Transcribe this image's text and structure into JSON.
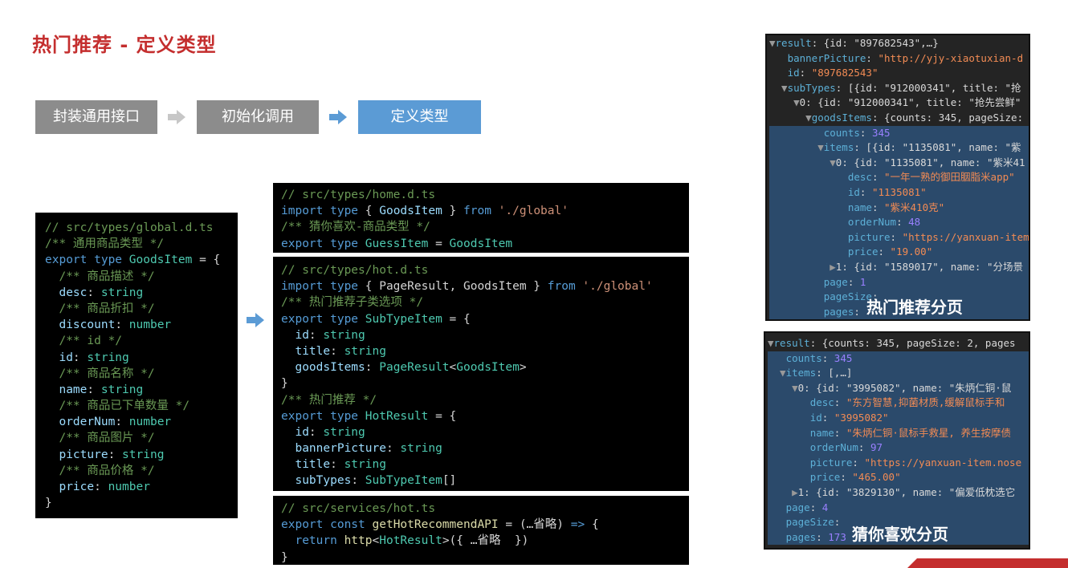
{
  "page_title": "热门推荐 - 定义类型",
  "steps": [
    {
      "label": "封装通用接口"
    },
    {
      "label": "初始化调用"
    },
    {
      "label": "定义类型"
    }
  ],
  "code_global": [
    [
      {
        "c": "c",
        "t": "// src/types/global.d.ts"
      }
    ],
    [
      {
        "c": "c",
        "t": "/** 通用商品类型 */"
      }
    ],
    [
      {
        "c": "k",
        "t": "export type "
      },
      {
        "c": "t",
        "t": "GoodsItem"
      },
      {
        "c": "w",
        "t": " = {"
      }
    ],
    [
      {
        "c": "c",
        "t": "  /** 商品描述 */"
      }
    ],
    [
      {
        "c": "p",
        "t": "  desc"
      },
      {
        "c": "w",
        "t": ": "
      },
      {
        "c": "t",
        "t": "string"
      }
    ],
    [
      {
        "c": "c",
        "t": "  /** 商品折扣 */"
      }
    ],
    [
      {
        "c": "p",
        "t": "  discount"
      },
      {
        "c": "w",
        "t": ": "
      },
      {
        "c": "t",
        "t": "number"
      }
    ],
    [
      {
        "c": "c",
        "t": "  /** id */"
      }
    ],
    [
      {
        "c": "p",
        "t": "  id"
      },
      {
        "c": "w",
        "t": ": "
      },
      {
        "c": "t",
        "t": "string"
      }
    ],
    [
      {
        "c": "c",
        "t": "  /** 商品名称 */"
      }
    ],
    [
      {
        "c": "p",
        "t": "  name"
      },
      {
        "c": "w",
        "t": ": "
      },
      {
        "c": "t",
        "t": "string"
      }
    ],
    [
      {
        "c": "c",
        "t": "  /** 商品已下单数量 */"
      }
    ],
    [
      {
        "c": "p",
        "t": "  orderNum"
      },
      {
        "c": "w",
        "t": ": "
      },
      {
        "c": "t",
        "t": "number"
      }
    ],
    [
      {
        "c": "c",
        "t": "  /** 商品图片 */"
      }
    ],
    [
      {
        "c": "p",
        "t": "  picture"
      },
      {
        "c": "w",
        "t": ": "
      },
      {
        "c": "t",
        "t": "string"
      }
    ],
    [
      {
        "c": "c",
        "t": "  /** 商品价格 */"
      }
    ],
    [
      {
        "c": "p",
        "t": "  price"
      },
      {
        "c": "w",
        "t": ": "
      },
      {
        "c": "t",
        "t": "number"
      }
    ],
    [
      {
        "c": "w",
        "t": "}"
      }
    ]
  ],
  "code_home": [
    [
      {
        "c": "c",
        "t": "// src/types/home.d.ts"
      }
    ],
    [
      {
        "c": "k",
        "t": "import type "
      },
      {
        "c": "w",
        "t": "{ "
      },
      {
        "c": "p",
        "t": "GoodsItem"
      },
      {
        "c": "w",
        "t": " } "
      },
      {
        "c": "k",
        "t": "from "
      },
      {
        "c": "s",
        "t": "'./global'"
      }
    ],
    [
      {
        "c": "c",
        "t": "/** 猜你喜欢-商品类型 */"
      }
    ],
    [
      {
        "c": "k",
        "t": "export type "
      },
      {
        "c": "t",
        "t": "GuessItem"
      },
      {
        "c": "w",
        "t": " = "
      },
      {
        "c": "t",
        "t": "GoodsItem"
      }
    ]
  ],
  "code_hot": [
    [
      {
        "c": "c",
        "t": "// src/types/hot.d.ts"
      }
    ],
    [
      {
        "c": "k",
        "t": "import type "
      },
      {
        "c": "w",
        "t": "{ PageResult, GoodsItem } "
      },
      {
        "c": "k",
        "t": "from "
      },
      {
        "c": "s",
        "t": "'./global'"
      }
    ],
    [
      {
        "c": "c",
        "t": "/** 热门推荐子类选项 */"
      }
    ],
    [
      {
        "c": "k",
        "t": "export type "
      },
      {
        "c": "t",
        "t": "SubTypeItem"
      },
      {
        "c": "w",
        "t": " = {"
      }
    ],
    [
      {
        "c": "p",
        "t": "  id"
      },
      {
        "c": "w",
        "t": ": "
      },
      {
        "c": "t",
        "t": "string"
      }
    ],
    [
      {
        "c": "p",
        "t": "  title"
      },
      {
        "c": "w",
        "t": ": "
      },
      {
        "c": "t",
        "t": "string"
      }
    ],
    [
      {
        "c": "p",
        "t": "  goodsItems"
      },
      {
        "c": "w",
        "t": ": "
      },
      {
        "c": "t",
        "t": "PageResult"
      },
      {
        "c": "w",
        "t": "<"
      },
      {
        "c": "t",
        "t": "GoodsItem"
      },
      {
        "c": "w",
        "t": ">"
      }
    ],
    [
      {
        "c": "w",
        "t": "}"
      }
    ],
    [
      {
        "c": "c",
        "t": "/** 热门推荐 */"
      }
    ],
    [
      {
        "c": "k",
        "t": "export type "
      },
      {
        "c": "t",
        "t": "HotResult"
      },
      {
        "c": "w",
        "t": " = {"
      }
    ],
    [
      {
        "c": "p",
        "t": "  id"
      },
      {
        "c": "w",
        "t": ": "
      },
      {
        "c": "t",
        "t": "string"
      }
    ],
    [
      {
        "c": "p",
        "t": "  bannerPicture"
      },
      {
        "c": "w",
        "t": ": "
      },
      {
        "c": "t",
        "t": "string"
      }
    ],
    [
      {
        "c": "p",
        "t": "  title"
      },
      {
        "c": "w",
        "t": ": "
      },
      {
        "c": "t",
        "t": "string"
      }
    ],
    [
      {
        "c": "p",
        "t": "  subTypes"
      },
      {
        "c": "w",
        "t": ": "
      },
      {
        "c": "t",
        "t": "SubTypeItem"
      },
      {
        "c": "w",
        "t": "[]"
      }
    ],
    [
      {
        "c": "w",
        "t": "}"
      }
    ]
  ],
  "code_service": [
    [
      {
        "c": "c",
        "t": "// src/services/hot.ts"
      }
    ],
    [
      {
        "c": "k",
        "t": "export const "
      },
      {
        "c": "f",
        "t": "getHotRecommendAPI"
      },
      {
        "c": "w",
        "t": " = (…省略) "
      },
      {
        "c": "k",
        "t": "=>"
      },
      {
        "c": "w",
        "t": " {"
      }
    ],
    [
      {
        "c": "k",
        "t": "  return "
      },
      {
        "c": "f",
        "t": "http"
      },
      {
        "c": "w",
        "t": "<"
      },
      {
        "c": "t",
        "t": "HotResult"
      },
      {
        "c": "w",
        "t": ">({ …省略  })"
      }
    ],
    [
      {
        "c": "w",
        "t": "}"
      }
    ]
  ],
  "devtools_hot": {
    "label": "热门推荐分页",
    "rows": [
      {
        "hl": false,
        "parts": [
          {
            "c": "dg",
            "t": "▼"
          },
          {
            "c": "dk",
            "t": "result"
          },
          {
            "c": "dp",
            "t": ": {id: \"897682543\",…}"
          }
        ]
      },
      {
        "hl": false,
        "parts": [
          {
            "c": "dp",
            "t": "   "
          },
          {
            "c": "dk",
            "t": "bannerPicture"
          },
          {
            "c": "dp",
            "t": ": "
          },
          {
            "c": "dv",
            "t": "\"http://yjy-xiaotuxian-d"
          }
        ]
      },
      {
        "hl": false,
        "parts": [
          {
            "c": "dp",
            "t": "   "
          },
          {
            "c": "dk",
            "t": "id"
          },
          {
            "c": "dp",
            "t": ": "
          },
          {
            "c": "dv",
            "t": "\"897682543\""
          }
        ]
      },
      {
        "hl": false,
        "parts": [
          {
            "c": "dg",
            "t": "  ▼"
          },
          {
            "c": "dk",
            "t": "subTypes"
          },
          {
            "c": "dp",
            "t": ": [{id: \"912000341\", title: \"抢"
          }
        ]
      },
      {
        "hl": false,
        "parts": [
          {
            "c": "dg",
            "t": "    ▼"
          },
          {
            "c": "dp",
            "t": "0: {id: \"912000341\", title: \"抢先尝鲜\""
          }
        ]
      },
      {
        "hl": false,
        "parts": [
          {
            "c": "dg",
            "t": "      ▼"
          },
          {
            "c": "dk",
            "t": "goodsItems"
          },
          {
            "c": "dp",
            "t": ": {counts: 345, pageSize:"
          }
        ]
      },
      {
        "hl": true,
        "parts": [
          {
            "c": "dp",
            "t": "         "
          },
          {
            "c": "dk",
            "t": "counts"
          },
          {
            "c": "dp",
            "t": ": "
          },
          {
            "c": "dn",
            "t": "345"
          }
        ]
      },
      {
        "hl": true,
        "parts": [
          {
            "c": "dg",
            "t": "        ▼"
          },
          {
            "c": "dk",
            "t": "items"
          },
          {
            "c": "dp",
            "t": ": [{id: \"1135081\", name: \"紫"
          }
        ]
      },
      {
        "hl": true,
        "parts": [
          {
            "c": "dg",
            "t": "          ▼"
          },
          {
            "c": "dp",
            "t": "0: {id: \"1135081\", name: \"紫米41"
          }
        ]
      },
      {
        "hl": true,
        "parts": [
          {
            "c": "dp",
            "t": "             "
          },
          {
            "c": "dk",
            "t": "desc"
          },
          {
            "c": "dp",
            "t": ": "
          },
          {
            "c": "dv",
            "t": "\"一年一熟的御田胭脂米app\""
          }
        ]
      },
      {
        "hl": true,
        "parts": [
          {
            "c": "dp",
            "t": "             "
          },
          {
            "c": "dk",
            "t": "id"
          },
          {
            "c": "dp",
            "t": ": "
          },
          {
            "c": "dv",
            "t": "\"1135081\""
          }
        ]
      },
      {
        "hl": true,
        "parts": [
          {
            "c": "dp",
            "t": "             "
          },
          {
            "c": "dk",
            "t": "name"
          },
          {
            "c": "dp",
            "t": ": "
          },
          {
            "c": "dv",
            "t": "\"紫米410克\""
          }
        ]
      },
      {
        "hl": true,
        "parts": [
          {
            "c": "dp",
            "t": "             "
          },
          {
            "c": "dk",
            "t": "orderNum"
          },
          {
            "c": "dp",
            "t": ": "
          },
          {
            "c": "dn",
            "t": "48"
          }
        ]
      },
      {
        "hl": true,
        "parts": [
          {
            "c": "dp",
            "t": "             "
          },
          {
            "c": "dk",
            "t": "picture"
          },
          {
            "c": "dp",
            "t": ": "
          },
          {
            "c": "dv",
            "t": "\"https://yanxuan-item"
          }
        ]
      },
      {
        "hl": true,
        "parts": [
          {
            "c": "dp",
            "t": "             "
          },
          {
            "c": "dk",
            "t": "price"
          },
          {
            "c": "dp",
            "t": ": "
          },
          {
            "c": "dv",
            "t": "\"19.00\""
          }
        ]
      },
      {
        "hl": true,
        "parts": [
          {
            "c": "dg",
            "t": "          ▶"
          },
          {
            "c": "dp",
            "t": "1: {id: \"1589017\", name: \"分场景"
          }
        ]
      },
      {
        "hl": true,
        "parts": [
          {
            "c": "dp",
            "t": "         "
          },
          {
            "c": "dk",
            "t": "page"
          },
          {
            "c": "dp",
            "t": ": "
          },
          {
            "c": "dn",
            "t": "1"
          }
        ]
      },
      {
        "hl": true,
        "parts": [
          {
            "c": "dp",
            "t": "         "
          },
          {
            "c": "dk",
            "t": "pageSize"
          },
          {
            "c": "dp",
            "t": ": "
          }
        ]
      },
      {
        "hl": true,
        "parts": [
          {
            "c": "dp",
            "t": "         "
          },
          {
            "c": "dk",
            "t": "pages"
          },
          {
            "c": "dp",
            "t": ": "
          }
        ]
      }
    ]
  },
  "devtools_guess": {
    "label": "猜你喜欢分页",
    "rows": [
      {
        "hl": false,
        "parts": [
          {
            "c": "dg",
            "t": "▼"
          },
          {
            "c": "dk",
            "t": "result"
          },
          {
            "c": "dp",
            "t": ": {counts: 345, pageSize: 2, pages"
          }
        ]
      },
      {
        "hl": true,
        "parts": [
          {
            "c": "dp",
            "t": "   "
          },
          {
            "c": "dk",
            "t": "counts"
          },
          {
            "c": "dp",
            "t": ": "
          },
          {
            "c": "dn",
            "t": "345"
          }
        ]
      },
      {
        "hl": true,
        "parts": [
          {
            "c": "dg",
            "t": "  ▼"
          },
          {
            "c": "dk",
            "t": "items"
          },
          {
            "c": "dp",
            "t": ": [,…]"
          }
        ]
      },
      {
        "hl": true,
        "parts": [
          {
            "c": "dg",
            "t": "    ▼"
          },
          {
            "c": "dp",
            "t": "0: {id: \"3995082\", name: \"朱炳仁铜·鼠"
          }
        ]
      },
      {
        "hl": true,
        "parts": [
          {
            "c": "dp",
            "t": "       "
          },
          {
            "c": "dk",
            "t": "desc"
          },
          {
            "c": "dp",
            "t": ": "
          },
          {
            "c": "dv",
            "t": "\"东方智慧,抑菌材质,缓解鼠标手和"
          }
        ]
      },
      {
        "hl": true,
        "parts": [
          {
            "c": "dp",
            "t": "       "
          },
          {
            "c": "dk",
            "t": "id"
          },
          {
            "c": "dp",
            "t": ": "
          },
          {
            "c": "dv",
            "t": "\"3995082\""
          }
        ]
      },
      {
        "hl": true,
        "parts": [
          {
            "c": "dp",
            "t": "       "
          },
          {
            "c": "dk",
            "t": "name"
          },
          {
            "c": "dp",
            "t": ": "
          },
          {
            "c": "dv",
            "t": "\"朱炳仁铜·鼠标手救星, 养生按摩债"
          }
        ]
      },
      {
        "hl": true,
        "parts": [
          {
            "c": "dp",
            "t": "       "
          },
          {
            "c": "dk",
            "t": "orderNum"
          },
          {
            "c": "dp",
            "t": ": "
          },
          {
            "c": "dn",
            "t": "97"
          }
        ]
      },
      {
        "hl": true,
        "parts": [
          {
            "c": "dp",
            "t": "       "
          },
          {
            "c": "dk",
            "t": "picture"
          },
          {
            "c": "dp",
            "t": ": "
          },
          {
            "c": "dv",
            "t": "\"https://yanxuan-item.nose"
          }
        ]
      },
      {
        "hl": true,
        "parts": [
          {
            "c": "dp",
            "t": "       "
          },
          {
            "c": "dk",
            "t": "price"
          },
          {
            "c": "dp",
            "t": ": "
          },
          {
            "c": "dv",
            "t": "\"465.00\""
          }
        ]
      },
      {
        "hl": true,
        "parts": [
          {
            "c": "dg",
            "t": "    ▶"
          },
          {
            "c": "dp",
            "t": "1: {id: \"3829130\", name: \"偏爱低枕选它"
          }
        ]
      },
      {
        "hl": true,
        "parts": [
          {
            "c": "dp",
            "t": "   "
          },
          {
            "c": "dk",
            "t": "page"
          },
          {
            "c": "dp",
            "t": ": "
          },
          {
            "c": "dn",
            "t": "4"
          }
        ]
      },
      {
        "hl": true,
        "parts": [
          {
            "c": "dp",
            "t": "   "
          },
          {
            "c": "dk",
            "t": "pageSize"
          },
          {
            "c": "dp",
            "t": ": "
          }
        ]
      },
      {
        "hl": true,
        "parts": [
          {
            "c": "dp",
            "t": "   "
          },
          {
            "c": "dk",
            "t": "pages"
          },
          {
            "c": "dp",
            "t": ": "
          },
          {
            "c": "dn",
            "t": "173"
          }
        ]
      }
    ]
  },
  "colors": {
    "title": "#c42e2e",
    "step_gray": "#8c8c8c",
    "step_active": "#5b9bd5",
    "arrow": "#5b9bd5"
  }
}
